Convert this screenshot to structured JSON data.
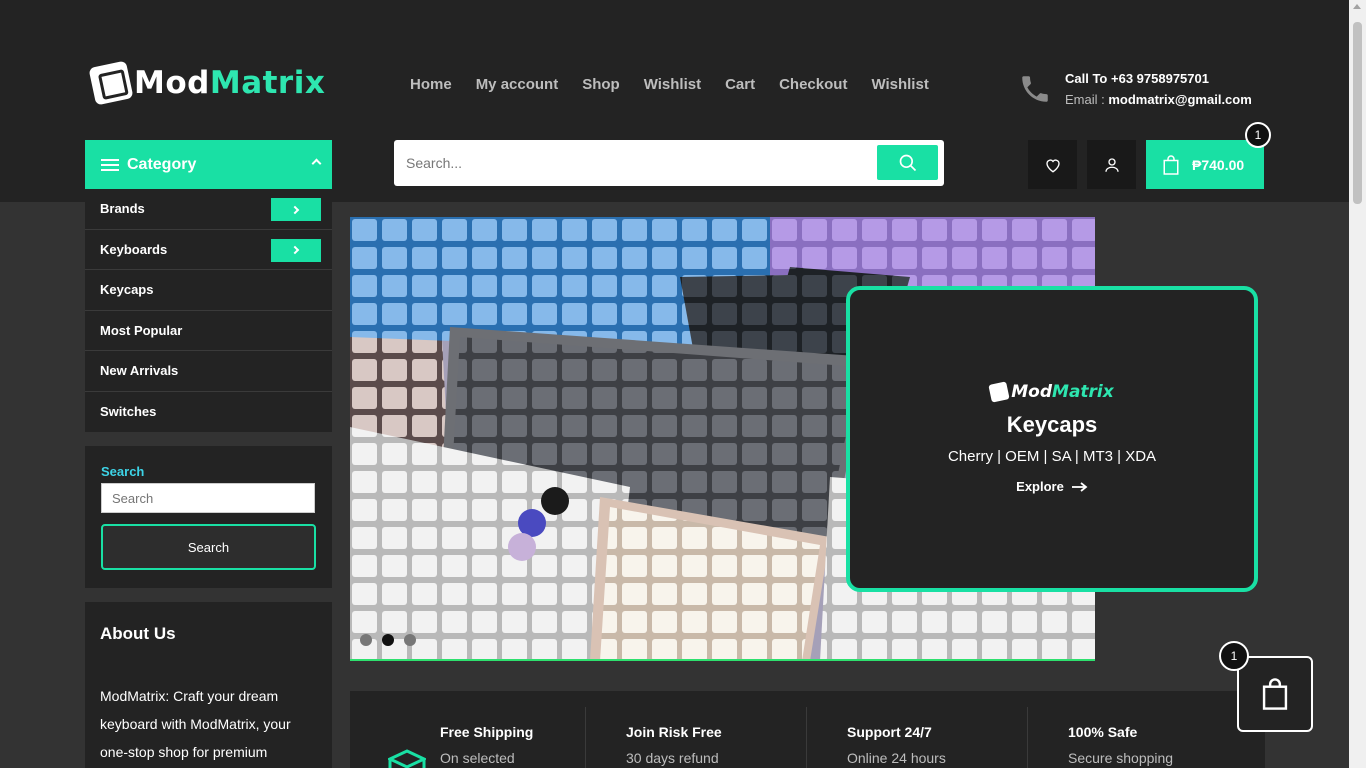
{
  "brand": {
    "name_part1": "Mod",
    "name_part2": "Matrix",
    "accent": "#19e0a4"
  },
  "nav": [
    "Home",
    "My account",
    "Shop",
    "Wishlist",
    "Cart",
    "Checkout",
    "Wishlist"
  ],
  "contact": {
    "call_label": "Call To",
    "phone": "+63 9758975701",
    "email_label": "Email :",
    "email": "modmatrix@gmail.com",
    "icon": "phone-icon"
  },
  "category": {
    "title": "Category",
    "items": [
      {
        "label": "Brands",
        "has_arrow": true
      },
      {
        "label": "Keyboards",
        "has_arrow": true
      },
      {
        "label": "Keycaps",
        "has_arrow": false
      },
      {
        "label": "Most Popular",
        "has_arrow": false
      },
      {
        "label": "New Arrivals",
        "has_arrow": false
      },
      {
        "label": "Switches",
        "has_arrow": false
      }
    ]
  },
  "search": {
    "placeholder": "Search...",
    "icon": "search-icon"
  },
  "header_actions": {
    "cart_total": "₱740.00",
    "cart_count": "1",
    "icons": [
      "heart-icon",
      "user-icon",
      "bag-icon"
    ]
  },
  "side_search": {
    "label": "Search",
    "placeholder": "Search",
    "button": "Search"
  },
  "about": {
    "title": "About Us",
    "text": "ModMatrix: Craft your dream keyboard with ModMatrix, your one-stop shop for premium"
  },
  "hero": {
    "slides": 3,
    "active_slide": 2
  },
  "promo": {
    "logo_part1": "Mod",
    "logo_part2": "Matrix",
    "title": "Keycaps",
    "types": "Cherry | OEM | SA | MT3 | XDA",
    "cta": "Explore"
  },
  "features": [
    {
      "title": "Free Shipping",
      "sub": "On selected"
    },
    {
      "title": "Join Risk Free",
      "sub": "30 days refund"
    },
    {
      "title": "Support 24/7",
      "sub": "Online 24 hours"
    },
    {
      "title": "100% Safe",
      "sub": "Secure shopping"
    }
  ],
  "floating_cart": {
    "count": "1"
  }
}
